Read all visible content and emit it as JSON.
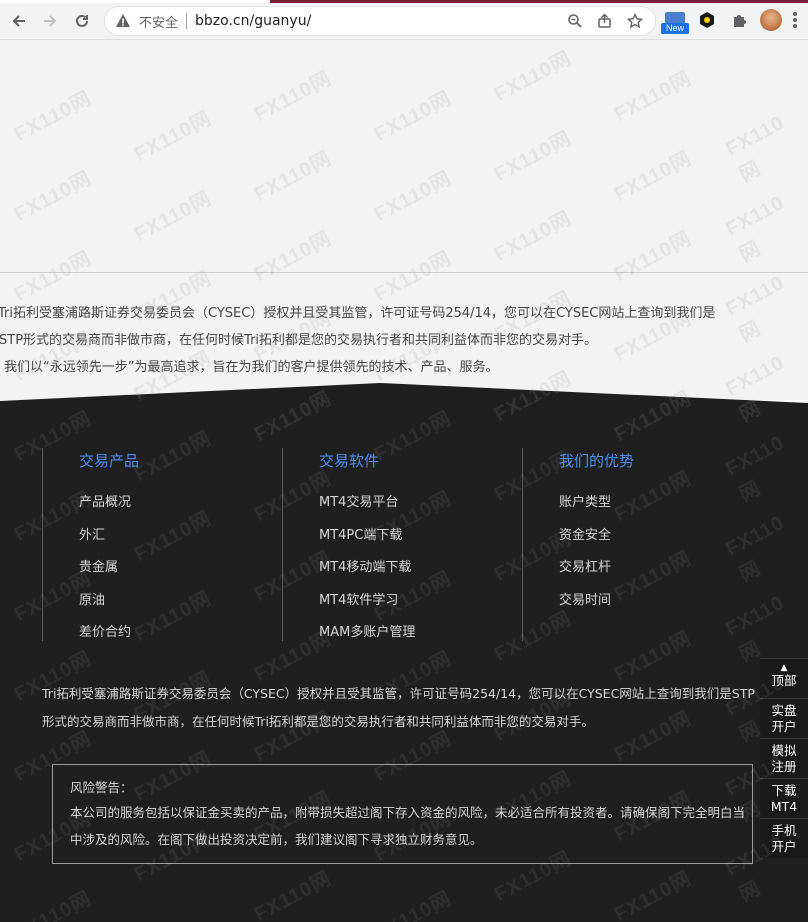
{
  "browser": {
    "security_label": "不安全",
    "url": "bbzo.cn/guanyu/",
    "new_badge": "New"
  },
  "intro": {
    "lines": [
      "Tri拓利受塞浦路斯证券交易委员会（CYSEC）授权并且受其监管，许可证号码254/14，您可以在CYSEC网站上查询到我们是",
      "STP形式的交易商而非做市商，在任何时候Tri拓利都是您的交易执行者和共同利益体而非您的交易对手。",
      "我们以“永远领先一步”为最高追求，旨在为我们的客户提供领先的技术、产品、服务。"
    ]
  },
  "footer": {
    "columns": [
      {
        "title": "交易产品",
        "items": [
          "产品概况",
          "外汇",
          "贵金属",
          "原油",
          "差价合约"
        ]
      },
      {
        "title": "交易软件",
        "items": [
          "MT4交易平台",
          "MT4PC端下载",
          "MT4移动端下载",
          "MT4软件学习",
          "MAM多账户管理"
        ]
      },
      {
        "title": "我们的优势",
        "items": [
          "账户类型",
          "资金安全",
          "交易杠杆",
          "交易时间"
        ]
      }
    ],
    "description": [
      "Tri拓利受塞浦路斯证券交易委员会（CYSEC）授权并且受其监管，许可证号码254/14，您可以在CYSEC网站上查询到我们是STP",
      "形式的交易商而非做市商，在任何时候Tri拓利都是您的交易执行者和共同利益体而非您的交易对手。"
    ],
    "risk": {
      "title": "风险警告：",
      "text": "本公司的服务包括以保证金买卖的产品，附带损失超过阁下存入资金的风险，未必适合所有投资者。请确保阁下完全明白当中涉及的风险。在阁下做出投资决定前，我们建议阁下寻求独立财务意见。"
    }
  },
  "side": {
    "top": [
      "顶部"
    ],
    "buttons": [
      [
        "实盘",
        "开户"
      ],
      [
        "模拟",
        "注册"
      ],
      [
        "下载",
        "MT4"
      ],
      [
        "手机",
        "开户"
      ]
    ]
  },
  "watermark": "FX110网",
  "colors": {
    "footer_bg": "#1f1f1f",
    "accent": "#4a8ef0",
    "chrome_accent": "#7a1f3a"
  }
}
